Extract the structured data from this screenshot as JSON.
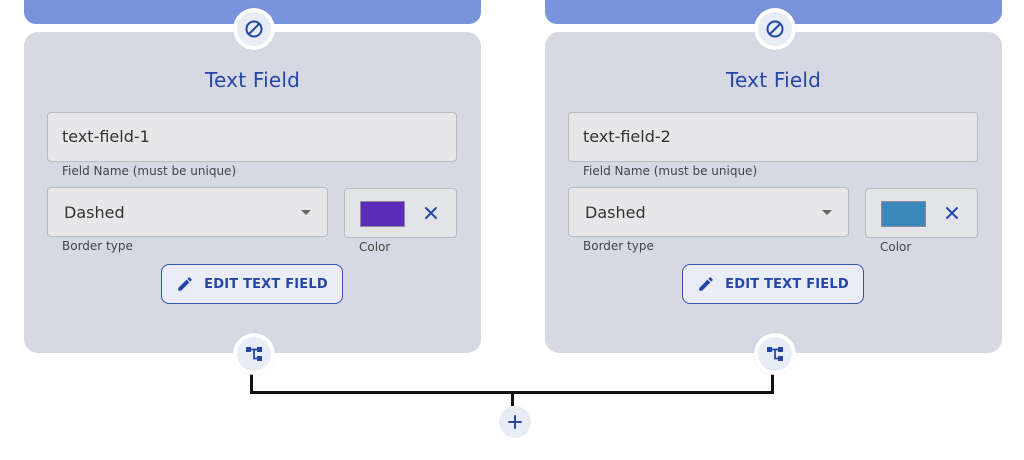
{
  "colors": {
    "accent": "#2447a6",
    "card_bg": "#d6d8e3",
    "top_bar": "#7993dc",
    "connector": "#111111"
  },
  "cards": [
    {
      "title": "Text Field",
      "field_name": {
        "value": "text-field-1",
        "helper": "Field Name (must be unique)"
      },
      "border_type": {
        "value": "Dashed",
        "helper": "Border type"
      },
      "color": {
        "swatch": "#5b2cb8",
        "helper": "Color"
      },
      "edit_button": {
        "label": "EDIT TEXT FIELD",
        "icon": "pencil-icon"
      },
      "top_icon": "ban-icon",
      "bottom_icon": "flow-tree-icon"
    },
    {
      "title": "Text Field",
      "field_name": {
        "value": "text-field-2",
        "helper": "Field Name (must be unique)"
      },
      "border_type": {
        "value": "Dashed",
        "helper": "Border type"
      },
      "color": {
        "swatch": "#3c88bd",
        "helper": "Color"
      },
      "edit_button": {
        "label": "EDIT TEXT FIELD",
        "icon": "pencil-icon"
      },
      "top_icon": "ban-icon",
      "bottom_icon": "flow-tree-icon"
    }
  ],
  "add_button": {
    "icon": "plus-icon"
  }
}
